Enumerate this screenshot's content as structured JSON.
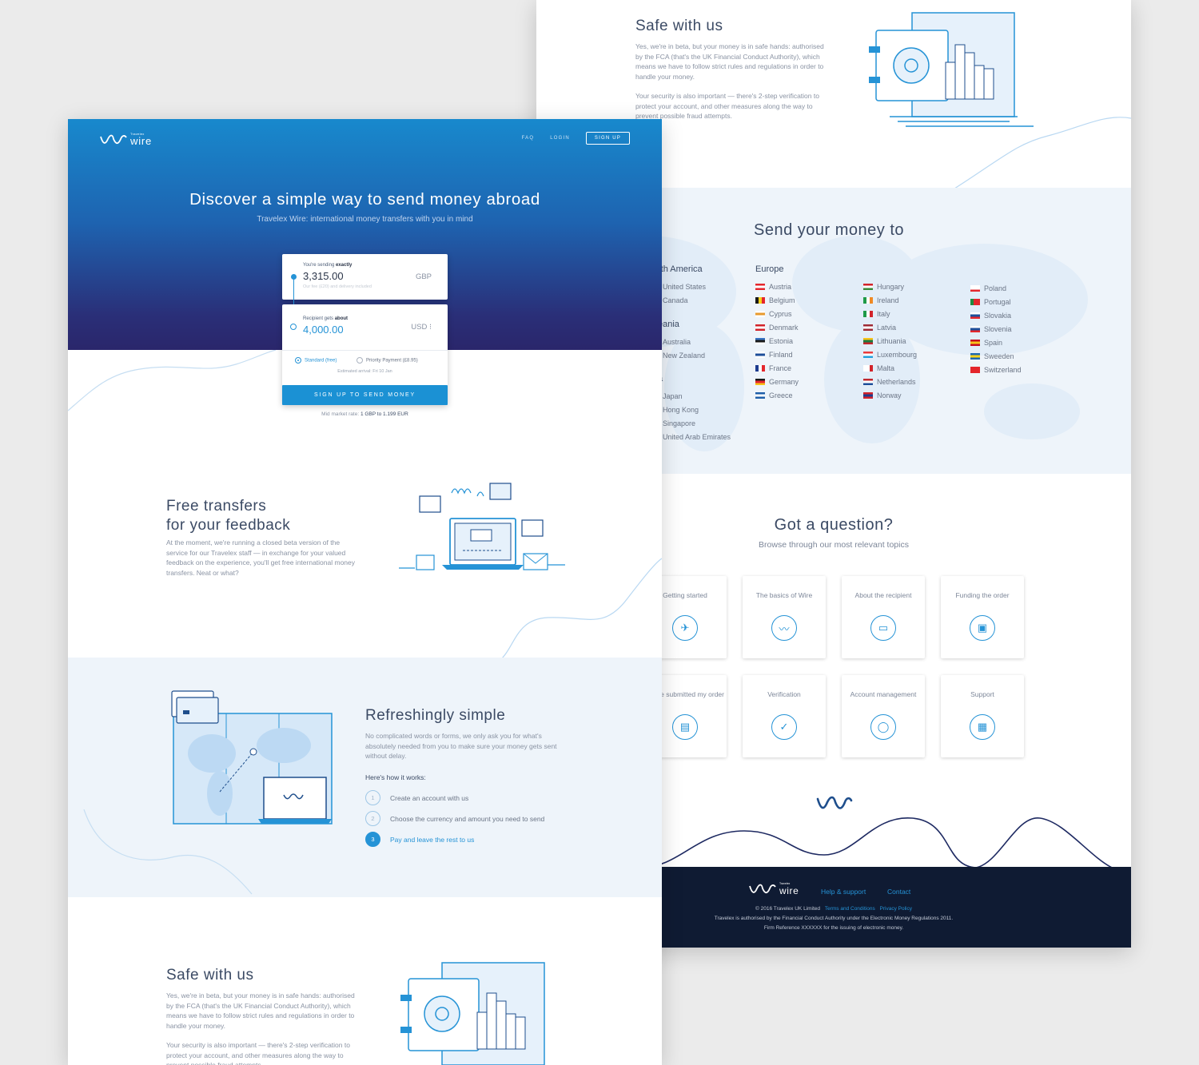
{
  "brand": {
    "small": "Travelex",
    "name": "wire"
  },
  "nav": {
    "faq": "FAQ",
    "login": "LOGIN",
    "signup": "SIGN UP"
  },
  "hero": {
    "title": "Discover a simple way to send money abroad",
    "subtitle": "Travelex Wire: international money transfers with you in mind"
  },
  "calculator": {
    "send_label": "You're sending",
    "send_label_bold": "exactly",
    "send_amount": "3,315.00",
    "send_currency": "GBP",
    "send_fee": "Our fee (£20) and delivery included",
    "receive_label": "Recipient gets",
    "receive_label_bold": "about",
    "receive_amount": "4,000.00",
    "receive_currency": "USD ⁝",
    "option_standard": "Standard  (free)",
    "option_priority": "Priority Payment (£8.95)",
    "arrival": "Estimated arrival: Fri 10 Jan",
    "cta": "SIGN UP TO SEND MONEY",
    "rate_label": "Mid market rate:",
    "rate_value": "1 GBP to 1.199 EUR"
  },
  "feedback": {
    "title_1": "Free transfers",
    "title_2": "for your feedback",
    "body": "At the moment, we're running a closed beta version of the service for our Travelex staff — in exchange for your valued feedback on the experience, you'll get free international money transfers. Neat or what?"
  },
  "simple": {
    "title": "Refreshingly simple",
    "body": "No complicated words or forms, we only ask you for what's absolutely needed from you to make sure your money gets sent without delay.",
    "how": "Here's how it works:",
    "steps": [
      {
        "num": "1",
        "label": "Create an account with us"
      },
      {
        "num": "2",
        "label": "Choose the currency and amount you need to send"
      },
      {
        "num": "3",
        "label": "Pay and leave the rest to us"
      }
    ]
  },
  "safe": {
    "title": "Safe with us",
    "body_1": "Yes, we're in beta, but your money is in safe hands: authorised by the FCA (that's the UK Financial Conduct Authority), which means we have to follow strict rules and regulations in order to handle your money.",
    "body_2": "Your security is also important — there's 2-step verification to protect your account, and other measures along the way to prevent possible fraud attempts."
  },
  "send_to": {
    "title": "Send your money to",
    "regions": [
      {
        "name": "rth America",
        "countries": [
          "United States",
          "Canada"
        ]
      },
      {
        "name": "eania",
        "countries": [
          "Australia",
          "New Zealand"
        ]
      },
      {
        "name": "a",
        "countries": [
          "Japan",
          "Hong Kong",
          "Singapore",
          "United Arab Emirates"
        ]
      }
    ],
    "europe_title": "Europe",
    "europe": [
      [
        {
          "name": "Austria",
          "flag": [
            "#e4262c",
            "#ffffff",
            "#e4262c"
          ],
          "dir": "h"
        },
        {
          "name": "Belgium",
          "flag": [
            "#1a1a1a",
            "#f7d21a",
            "#e4262c"
          ],
          "dir": "v"
        },
        {
          "name": "Cyprus",
          "flag": [
            "#ffffff",
            "#e89a2e",
            "#ffffff"
          ],
          "dir": "h"
        },
        {
          "name": "Denmark",
          "flag": [
            "#d2232a",
            "#ffffff",
            "#d2232a"
          ],
          "dir": "h"
        },
        {
          "name": "Estonia",
          "flag": [
            "#3a75c4",
            "#1a1a1a",
            "#ffffff"
          ],
          "dir": "h"
        },
        {
          "name": "Finland",
          "flag": [
            "#ffffff",
            "#1d4e9a",
            "#ffffff"
          ],
          "dir": "h"
        },
        {
          "name": "France",
          "flag": [
            "#1d3c8f",
            "#ffffff",
            "#e4262c"
          ],
          "dir": "v"
        },
        {
          "name": "Germany",
          "flag": [
            "#1a1a1a",
            "#e4262c",
            "#f7c31a"
          ],
          "dir": "h"
        },
        {
          "name": "Greece",
          "flag": [
            "#1f5fa9",
            "#ffffff",
            "#1f5fa9"
          ],
          "dir": "h"
        }
      ],
      [
        {
          "name": "Hungary",
          "flag": [
            "#d2232a",
            "#ffffff",
            "#3a8a3a"
          ],
          "dir": "h"
        },
        {
          "name": "Ireland",
          "flag": [
            "#1f9a48",
            "#ffffff",
            "#f08a24"
          ],
          "dir": "v"
        },
        {
          "name": "Italy",
          "flag": [
            "#1f9a48",
            "#ffffff",
            "#d2232a"
          ],
          "dir": "v"
        },
        {
          "name": "Latvia",
          "flag": [
            "#9e2a35",
            "#ffffff",
            "#9e2a35"
          ],
          "dir": "h"
        },
        {
          "name": "Lithuania",
          "flag": [
            "#f7c31a",
            "#1f7a3f",
            "#c1272d"
          ],
          "dir": "h"
        },
        {
          "name": "Luxembourg",
          "flag": [
            "#ea3b3b",
            "#ffffff",
            "#23a0dc"
          ],
          "dir": "h"
        },
        {
          "name": "Malta",
          "flag": [
            "#ffffff",
            "#ffffff",
            "#d2232a"
          ],
          "dir": "v"
        },
        {
          "name": "Netherlands",
          "flag": [
            "#c0262d",
            "#ffffff",
            "#1d4e9a"
          ],
          "dir": "h"
        },
        {
          "name": "Norway",
          "flag": [
            "#d2232a",
            "#1d3c8f",
            "#d2232a"
          ],
          "dir": "h"
        }
      ],
      [
        {
          "name": "Poland",
          "flag": [
            "#ffffff",
            "#ffffff",
            "#e4262c"
          ],
          "dir": "h"
        },
        {
          "name": "Portugal",
          "flag": [
            "#1f8a3f",
            "#e4262c",
            "#e4262c"
          ],
          "dir": "v"
        },
        {
          "name": "Slovakia",
          "flag": [
            "#ffffff",
            "#1d4e9a",
            "#e4262c"
          ],
          "dir": "h"
        },
        {
          "name": "Slovenia",
          "flag": [
            "#ffffff",
            "#1d4e9a",
            "#e4262c"
          ],
          "dir": "h"
        },
        {
          "name": "Spain",
          "flag": [
            "#c60b1e",
            "#f7c31a",
            "#c60b1e"
          ],
          "dir": "h"
        },
        {
          "name": "Sweeden",
          "flag": [
            "#1d6ab1",
            "#f7d21a",
            "#1d6ab1"
          ],
          "dir": "h"
        },
        {
          "name": "Switzerland",
          "flag": [
            "#e4262c",
            "#e4262c",
            "#e4262c"
          ],
          "dir": "h"
        }
      ]
    ]
  },
  "faq": {
    "title": "Got a question?",
    "subtitle": "Browse through our most relevant topics",
    "tiles": [
      {
        "label": "Getting started",
        "icon": "plane-icon"
      },
      {
        "label": "The basics of Wire",
        "icon": "wire-icon"
      },
      {
        "label": "About the recipient",
        "icon": "id-card-icon"
      },
      {
        "label": "Funding the order",
        "icon": "banknote-icon"
      },
      {
        "label": "er I've submitted my order",
        "icon": "document-icon"
      },
      {
        "label": "Verification",
        "icon": "check-icon"
      },
      {
        "label": "Account management",
        "icon": "user-icon"
      },
      {
        "label": "Support",
        "icon": "chat-icon"
      }
    ]
  },
  "footer": {
    "help": "Help & support",
    "contact": "Contact",
    "copyright": "© 2016 Travelex UK Limited",
    "terms": "Terms and Conditions",
    "privacy": "Privacy Policy",
    "legal_1": "Travelex is authorised by the Financial Conduct Authority under the Electronic Money Regulations 2011.",
    "legal_2": "Firm Reference XXXXXX for the issuing of electronic money."
  },
  "colors": {
    "accent": "#2593d6",
    "navy": "#0f1b33",
    "hero_top": "#1889cd",
    "hero_bottom": "#2a266b",
    "soft_bg": "#eef4fa"
  }
}
